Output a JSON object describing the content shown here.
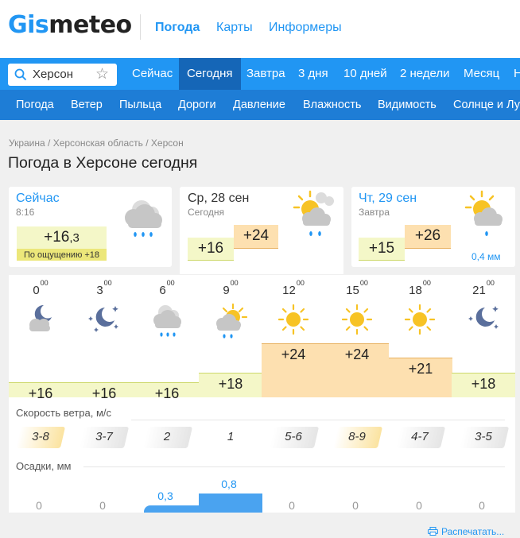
{
  "logo": {
    "part1": "Gis",
    "part2": "meteo"
  },
  "top_nav": [
    "Погода",
    "Карты",
    "Информеры"
  ],
  "search": {
    "value": "Херсон"
  },
  "tabs1": [
    "Сейчас",
    "Сегодня",
    "Завтра",
    "3 дня",
    "10 дней",
    "2 недели",
    "Месяц",
    "Н"
  ],
  "tabs2": [
    "Погода",
    "Ветер",
    "Пыльца",
    "Дороги",
    "Давление",
    "Влажность",
    "Видимость",
    "Солнце и Лу"
  ],
  "breadcrumb": "Украина / Херсонская область / Херсон",
  "page_title": "Погода в Херсоне сегодня",
  "now": {
    "title": "Сейчас",
    "time": "8:16",
    "temp_main": "+16",
    "temp_dec": ",3",
    "feels": "По ощущению +18"
  },
  "today": {
    "title": "Ср, 28 сен",
    "sub": "Сегодня",
    "min": "+16",
    "max": "+24"
  },
  "tomorrow": {
    "title": "Чт, 29 сен",
    "sub": "Завтра",
    "min": "+15",
    "max": "+26",
    "precip": "0,4 мм"
  },
  "hours": [
    "0",
    "3",
    "6",
    "9",
    "12",
    "15",
    "18",
    "21"
  ],
  "hour_minutes": "00",
  "temps": [
    "+16",
    "+16",
    "+16",
    "+18",
    "+24",
    "+24",
    "+21",
    "+18"
  ],
  "temp_values": [
    16,
    16,
    16,
    18,
    24,
    24,
    21,
    18
  ],
  "icons": [
    "moon-cloud-icon",
    "moon-stars-icon",
    "rain-cloud-icon",
    "sun-cloud-rain-icon",
    "sun-icon",
    "sun-icon",
    "sun-icon",
    "moon-stars-icon"
  ],
  "wind_label": "Скорость ветра, м/с",
  "wind": [
    "3-8",
    "3-7",
    "2",
    "1",
    "5-6",
    "8-9",
    "4-7",
    "3-5"
  ],
  "precip_label": "Осадки, мм",
  "precip": [
    "0",
    "0",
    "0,3",
    "0,8",
    "0",
    "0",
    "0",
    "0"
  ],
  "precip_values": [
    0,
    0,
    0.3,
    0.8,
    0,
    0,
    0,
    0
  ],
  "print": "Распечатать...",
  "colors": {
    "accent": "#2196f3",
    "nav_dark": "#1566b7",
    "warm": "#fde0b0",
    "cool": "#f4f7c8",
    "rain": "#4aa3f0"
  }
}
